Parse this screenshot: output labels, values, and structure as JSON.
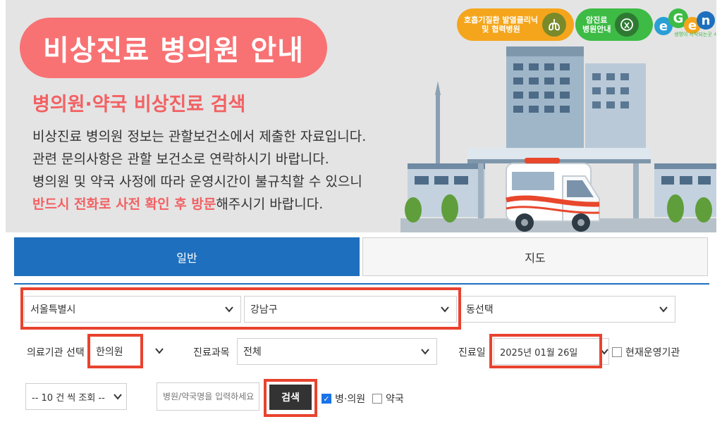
{
  "banner": {
    "title": "비상진료 병의원 안내",
    "subtitle": "병의원·약국 비상진료 검색",
    "desc_line1": "비상진료 병의원 정보는 관할보건소에서 제출한 자료입니다.",
    "desc_line2": "관련 문의사항은 관할 보건소로 연락하시기 바랍니다.",
    "desc_line3": "병의원 및 약국 사정에 따라 운영시간이 불규칙할 수 있으니",
    "desc_line4_highlight": "반드시 전화로 사전 확인 후 방문",
    "desc_line4_rest": "해주시기 바랍니다.",
    "chip_orange_line1": "호흡기질환 발열클리닉",
    "chip_orange_line2": "및 협력병원",
    "chip_green_line1": "암진료",
    "chip_green_line2": "병원안내",
    "logo_letters": [
      "e",
      "G",
      "e",
      "n"
    ],
    "logo_tagline": "생명이 시작되는곳 서울"
  },
  "tabs": {
    "general": "일반",
    "map": "지도"
  },
  "form": {
    "city_value": "서울특별시",
    "district_value": "강남구",
    "dong_value": "동선택",
    "institution_label": "의료기관 선택",
    "institution_value": "한의원",
    "department_label": "진료과목",
    "department_value": "전체",
    "date_label": "진료일",
    "date_value": "2025년 01월 26일",
    "operating_label": "현재운영기관",
    "page_size_value": "-- 10 건 씩 조회 --",
    "search_placeholder": "병원/약국명을 입력하세요",
    "search_button": "검색",
    "filter_hospital": "병·의원",
    "filter_pharmacy": "약국"
  },
  "colors": {
    "brand_blue": "#1e6fbd",
    "accent_red": "#f26163",
    "highlight_box": "#e8432f"
  },
  "icons": [
    "lungs-icon",
    "ribbon-icon",
    "chevron-down-icon",
    "checkbox-checked-icon",
    "checkbox-icon"
  ]
}
